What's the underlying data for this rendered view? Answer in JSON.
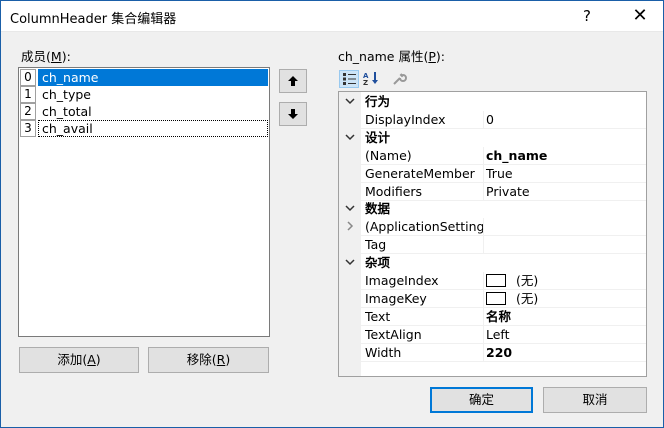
{
  "window": {
    "title": "ColumnHeader 集合编辑器",
    "help": "?",
    "close": "✕"
  },
  "members": {
    "label_pre": "成员(",
    "label_key": "M",
    "label_post": "):",
    "items": [
      {
        "index": "0",
        "name": "ch_name"
      },
      {
        "index": "1",
        "name": "ch_type"
      },
      {
        "index": "2",
        "name": "ch_total"
      },
      {
        "index": "3",
        "name": "ch_avail"
      }
    ],
    "add_pre": "添加(",
    "add_key": "A",
    "add_post": ")",
    "remove_pre": "移除(",
    "remove_key": "R",
    "remove_post": ")"
  },
  "properties": {
    "label_pre": "ch_name 属性(",
    "label_key": "P",
    "label_post": "):",
    "rows": [
      {
        "type": "cat",
        "name": "行为",
        "expander": "v"
      },
      {
        "type": "prop",
        "name": "DisplayIndex",
        "value": "0"
      },
      {
        "type": "cat",
        "name": "设计",
        "expander": "v"
      },
      {
        "type": "prop",
        "name": "(Name)",
        "value": "ch_name",
        "bold": true
      },
      {
        "type": "prop",
        "name": "GenerateMember",
        "value": "True"
      },
      {
        "type": "prop",
        "name": "Modifiers",
        "value": "Private"
      },
      {
        "type": "cat",
        "name": "数据",
        "expander": "v"
      },
      {
        "type": "prop",
        "name": "(ApplicationSettings)",
        "value": "",
        "expander": ">"
      },
      {
        "type": "prop",
        "name": "Tag",
        "value": ""
      },
      {
        "type": "cat",
        "name": "杂项",
        "expander": "v"
      },
      {
        "type": "prop",
        "name": "ImageIndex",
        "value": "(无)",
        "box": true
      },
      {
        "type": "prop",
        "name": "ImageKey",
        "value": "(无)",
        "box": true
      },
      {
        "type": "prop",
        "name": "Text",
        "value": "名称",
        "bold": true
      },
      {
        "type": "prop",
        "name": "TextAlign",
        "value": "Left"
      },
      {
        "type": "prop",
        "name": "Width",
        "value": "220",
        "bold": true
      }
    ]
  },
  "footer": {
    "ok": "确定",
    "cancel": "取消"
  },
  "colors": {
    "selection": "#0078d7",
    "border_accent": "#1a5fa8"
  }
}
